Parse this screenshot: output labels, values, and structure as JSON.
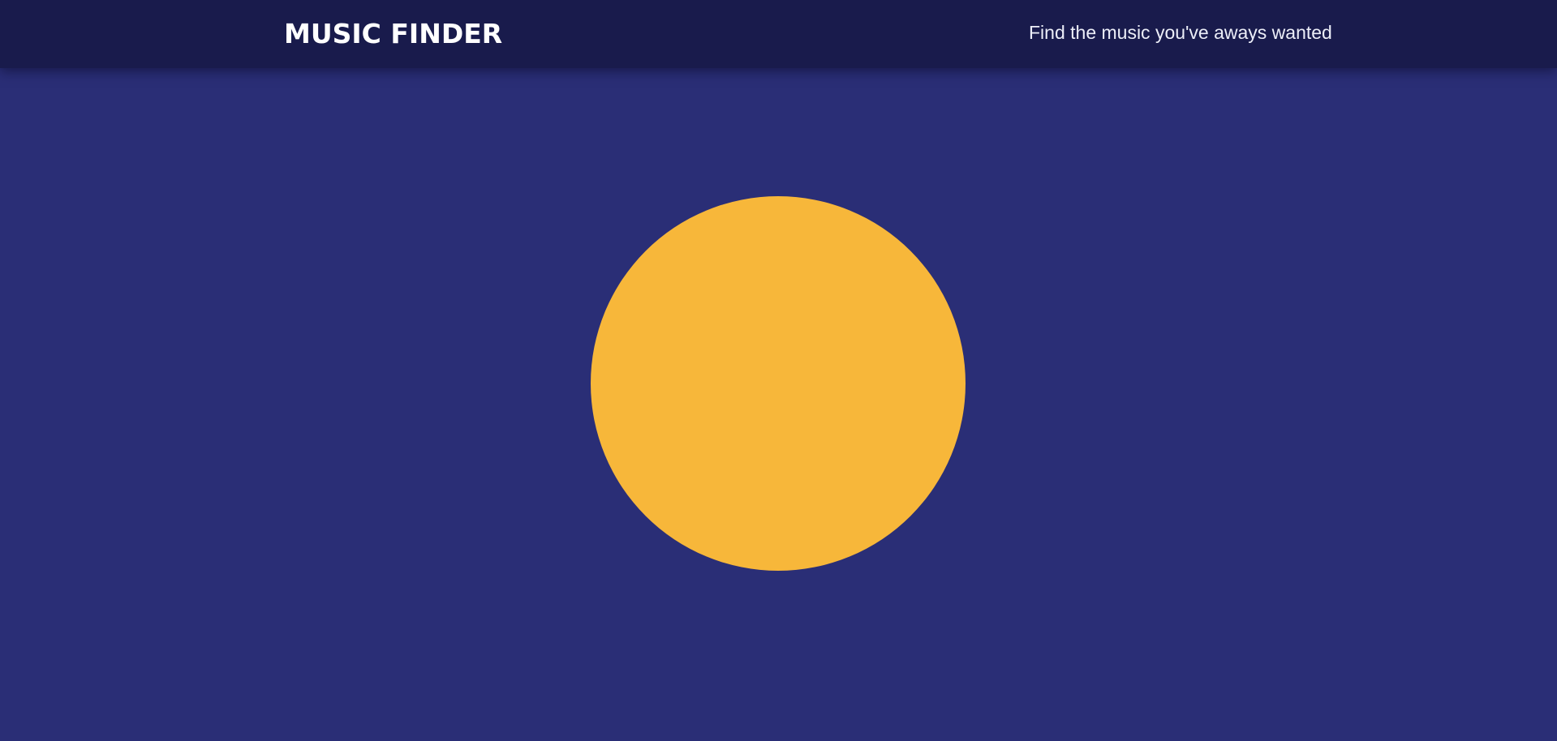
{
  "header": {
    "logo_text": "MUSIC FINDER",
    "tagline": "Find the music you've aways wanted"
  },
  "colors": {
    "header_background": "#191b4c",
    "page_background": "#2a2e76",
    "circle": "#f7b73a",
    "text": "#ffffff"
  }
}
